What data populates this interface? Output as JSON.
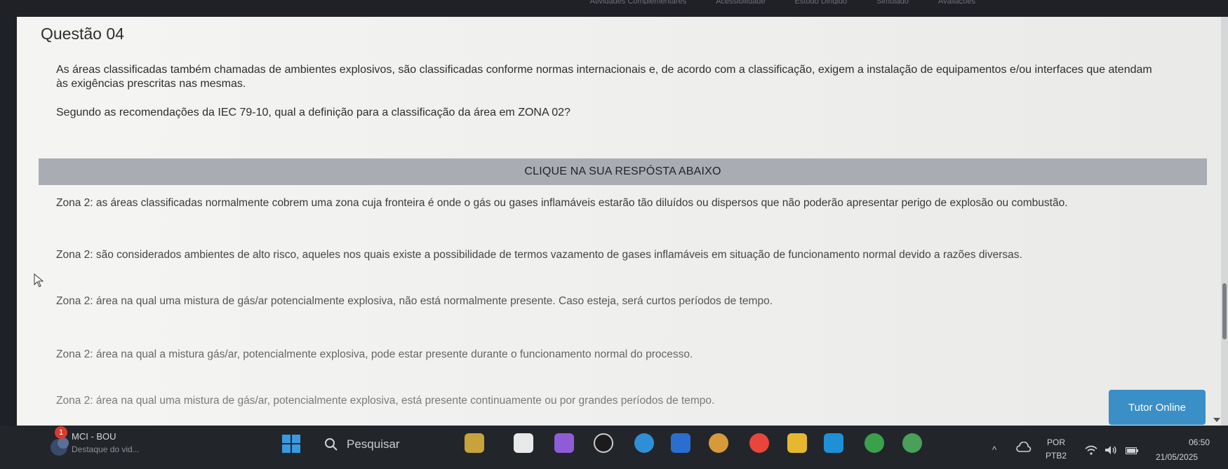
{
  "topnav": {
    "items": [
      "Atividades Complementares",
      "Acessibilidade",
      "Estudo Dirigido",
      "Simulado",
      "Avaliações"
    ]
  },
  "question": {
    "title": "Questão 04",
    "statement": "As áreas classificadas também chamadas de ambientes explosivos, são classificadas conforme normas internacionais e, de acordo com a classificação, exigem a instalação de equipamentos e/ou interfaces que atendam às exigências prescritas nas mesmas.",
    "prompt": "Segundo as recomendações da IEC 79-10, qual a definição para a classificação da área em ZONA 02?",
    "answer_band": "CLIQUE NA SUA RESPÓSTA ABAIXO",
    "options": [
      "Zona 2: as áreas classificadas normalmente cobrem uma zona cuja fronteira é onde o gás ou gases inflamáveis estarão tão diluídos ou dispersos que não poderão apresentar perigo de explosão ou combustão.",
      "Zona 2: são considerados ambientes de alto risco, aqueles nos quais existe a possibilidade de termos vazamento de gases inflamáveis em situação de funcionamento normal devido a razões diversas.",
      "Zona 2: área na qual uma mistura de gás/ar potencialmente explosiva, não está normalmente presente. Caso esteja, será curtos períodos de tempo.",
      "Zona 2: área na qual a mistura gás/ar, potencialmente explosiva, pode estar presente durante o funcionamento normal do processo.",
      "Zona 2: área na qual uma mistura de gás/ar, potencialmente explosiva, está presente continuamente ou por grandes períodos de tempo."
    ]
  },
  "tutor_button": "Tutor Online",
  "taskbar": {
    "notification_count": "1",
    "news_title": "MCI - BOU",
    "news_subtitle": "Destaque do vid...",
    "search_label": "Pesquisar",
    "lang_primary": "POR",
    "lang_secondary": "PTB2",
    "time": "06:50",
    "date": "21/05/2025"
  },
  "colors": {
    "accent": "#3b8fc7",
    "band": "#a9adb3",
    "taskbar": "#22262b"
  }
}
